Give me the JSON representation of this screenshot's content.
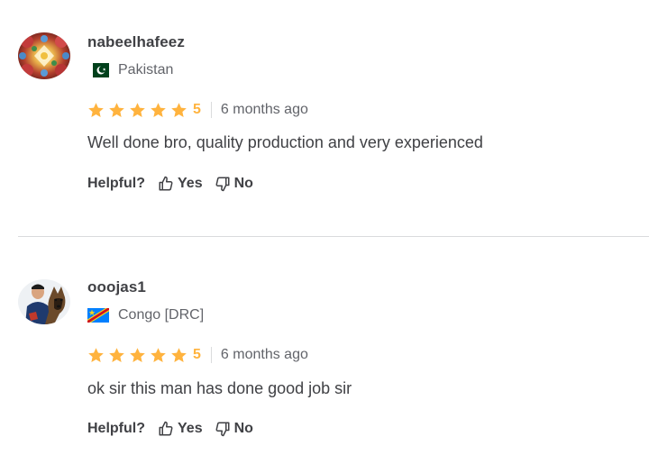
{
  "colors": {
    "star": "#ffb33e",
    "text_primary": "#404145",
    "text_secondary": "#62646a",
    "divider": "#dadbdd"
  },
  "reviews": [
    {
      "username": "nabeelhafeez",
      "country": "Pakistan",
      "flag_icon": "pakistan-flag-icon",
      "rating": "5",
      "time_ago": "6 months ago",
      "text": "Well done bro, quality production and very experienced",
      "helpful_label": "Helpful?",
      "yes_label": "Yes",
      "no_label": "No"
    },
    {
      "username": "ooojas1",
      "country": "Congo [DRC]",
      "flag_icon": "drc-flag-icon",
      "rating": "5",
      "time_ago": "6 months ago",
      "text": "ok sir this man has done good job sir",
      "helpful_label": "Helpful?",
      "yes_label": "Yes",
      "no_label": "No"
    }
  ]
}
